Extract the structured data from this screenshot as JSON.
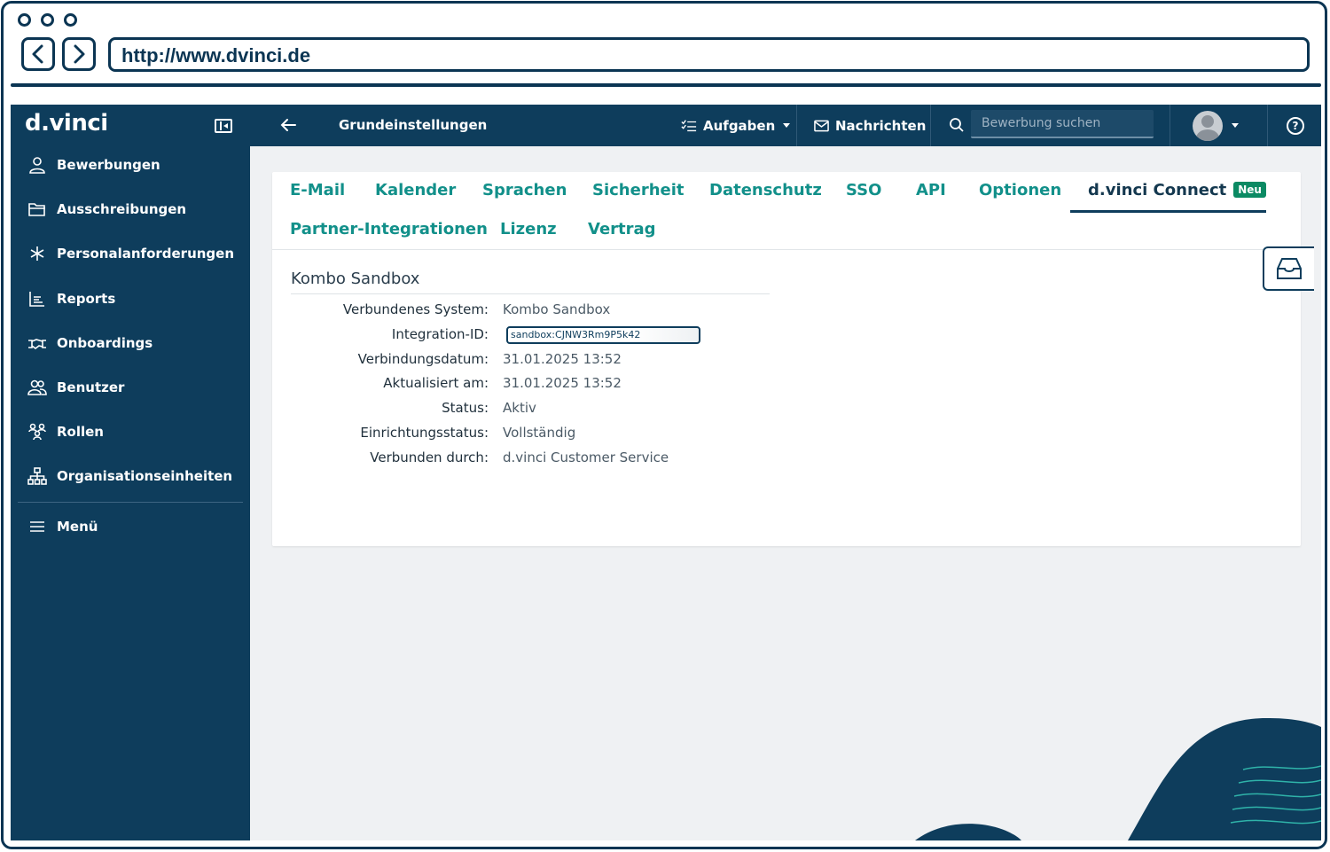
{
  "browser": {
    "url": "http://www.dvinci.de"
  },
  "app": {
    "brand": "d.vinci",
    "sidebar": {
      "items": [
        {
          "label": "Bewerbungen",
          "icon": "person-icon"
        },
        {
          "label": "Ausschreibungen",
          "icon": "folder-icon"
        },
        {
          "label": "Personalanforderungen",
          "icon": "asterisk-icon"
        },
        {
          "label": "Reports",
          "icon": "chart-icon"
        },
        {
          "label": "Onboardings",
          "icon": "handshake-icon"
        },
        {
          "label": "Benutzer",
          "icon": "users-icon"
        },
        {
          "label": "Rollen",
          "icon": "roles-icon"
        },
        {
          "label": "Organisationseinheiten",
          "icon": "org-chart-icon"
        }
      ],
      "menu": {
        "label": "Menü",
        "icon": "hamburger-icon"
      }
    },
    "topbar": {
      "breadcrumb": "Grundeinstellungen",
      "tasks": "Aufgaben",
      "messages": "Nachrichten",
      "search_placeholder": "Bewerbung suchen"
    },
    "tabs": [
      {
        "label": "E-Mail"
      },
      {
        "label": "Kalender"
      },
      {
        "label": "Sprachen"
      },
      {
        "label": "Sicherheit"
      },
      {
        "label": "Datenschutz"
      },
      {
        "label": "SSO"
      },
      {
        "label": "API"
      },
      {
        "label": "Optionen"
      },
      {
        "label": "d.vinci Connect",
        "badge": "Neu",
        "active": true
      },
      {
        "label": "Partner-Integrationen"
      },
      {
        "label": "Lizenz"
      },
      {
        "label": "Vertrag"
      }
    ],
    "connection": {
      "title": "Kombo Sandbox",
      "fields": [
        {
          "label": "Verbundenes System:",
          "value": "Kombo Sandbox"
        },
        {
          "label": "Integration-ID:",
          "value": "sandbox:CJNW3Rm9P5k42"
        },
        {
          "label": "Verbindungsdatum:",
          "value": "31.01.2025 13:52"
        },
        {
          "label": "Aktualisiert am:",
          "value": "31.01.2025 13:52"
        },
        {
          "label": "Status:",
          "value": "Aktiv"
        },
        {
          "label": "Einrichtungsstatus:",
          "value": "Vollständig"
        },
        {
          "label": "Verbunden durch:",
          "value": "d.vinci Customer Service"
        }
      ]
    },
    "colors": {
      "primary": "#0e3d5c",
      "accent": "#12908a",
      "badge": "#0b8a63"
    }
  }
}
